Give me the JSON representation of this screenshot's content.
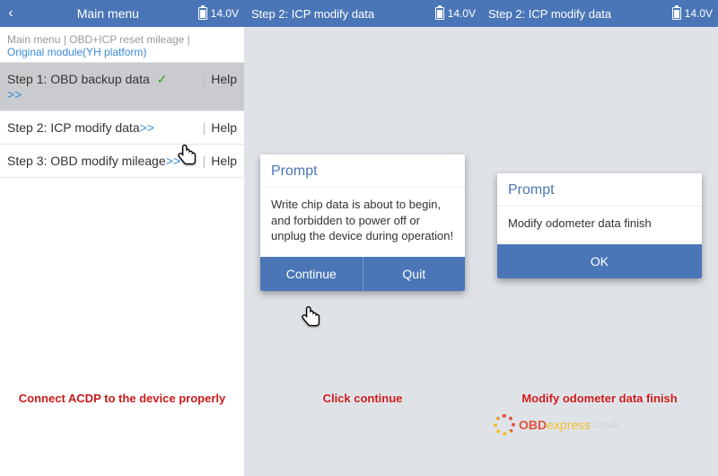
{
  "panels": [
    {
      "title": "Main menu",
      "voltage": "14.0V"
    },
    {
      "title": "Step 2: ICP modify data",
      "voltage": "14.0V"
    },
    {
      "title": "Step 2: ICP modify data",
      "voltage": "14.0V"
    }
  ],
  "breadcrumb": {
    "seg1": "Main menu",
    "seg2": "OBD+ICP reset mileage",
    "active": "Original module(YH platform)"
  },
  "steps": [
    {
      "label": "Step 1: OBD backup data",
      "done": true,
      "arrow": ">>",
      "help": "Help"
    },
    {
      "label": "Step 2: ICP modify data",
      "done": false,
      "arrow": ">>",
      "help": "Help"
    },
    {
      "label": "Step 3: OBD modify mileage",
      "done": false,
      "arrow": ">>",
      "help": "Help"
    }
  ],
  "captions": [
    "Connect ACDP to the device properly",
    "Click continue",
    "Modify odometer data finish"
  ],
  "prompt1": {
    "title": "Prompt",
    "body": "Write chip data is about to begin, and forbidden to power off or unplug the device during operation!",
    "continue": "Continue",
    "quit": "Quit"
  },
  "prompt2": {
    "title": "Prompt",
    "body": "Modify odometer data finish",
    "ok": "OK"
  },
  "watermark": {
    "brand1": "O",
    "brand2": "BD",
    "brand3": "express",
    "tail": ".co.uk"
  }
}
